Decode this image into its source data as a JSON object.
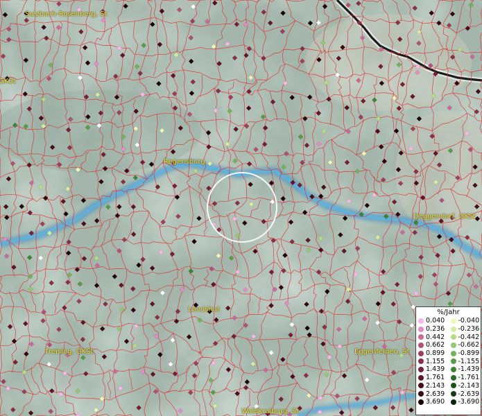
{
  "places": [
    {
      "id": "sulzbach",
      "label": "Sulzbach-Rosenberg, St"
    },
    {
      "id": "gkst-left",
      "label": "GKSt"
    },
    {
      "id": "regensburg",
      "label": "Regensburg"
    },
    {
      "id": "deggendorf",
      "label": "Deggendorf, GKSt"
    },
    {
      "id": "landshut",
      "label": "Landshut"
    },
    {
      "id": "freising",
      "label": "Freising, GKSt"
    },
    {
      "id": "eggenfelden",
      "label": "Eggenfelden, St"
    },
    {
      "id": "waldkraiburg",
      "label": "Waldkraiburg, St"
    }
  ],
  "legend": {
    "title": "%/Jahr",
    "positive": [
      {
        "value": "0.040",
        "color": "#f7b8e6"
      },
      {
        "value": "0.236",
        "color": "#e48cc4"
      },
      {
        "value": "0.442",
        "color": "#c96a98"
      },
      {
        "value": "0.662",
        "color": "#b25176"
      },
      {
        "value": "0.899",
        "color": "#9e3f5c"
      },
      {
        "value": "1.155",
        "color": "#8b2f48"
      },
      {
        "value": "1.439",
        "color": "#771f37"
      },
      {
        "value": "1.761",
        "color": "#621428"
      },
      {
        "value": "2.143",
        "color": "#4c0b1b"
      },
      {
        "value": "2.639",
        "color": "#330410"
      },
      {
        "value": "3.690",
        "color": "#1a0006"
      }
    ],
    "negative": [
      {
        "value": "-0.040",
        "color": "#eef6b8"
      },
      {
        "value": "-0.236",
        "color": "#d6eca0"
      },
      {
        "value": "-0.442",
        "color": "#b6dc88"
      },
      {
        "value": "-0.662",
        "color": "#94c870"
      },
      {
        "value": "-0.899",
        "color": "#74b35a"
      },
      {
        "value": "-1.155",
        "color": "#579c46"
      },
      {
        "value": "-1.439",
        "color": "#3e8434"
      },
      {
        "value": "-1.761",
        "color": "#2a6c25"
      },
      {
        "value": "-2.143",
        "color": "#1b5419"
      },
      {
        "value": "-2.639",
        "color": "#0f3d0f"
      },
      {
        "value": "-3.690",
        "color": "#062606"
      }
    ]
  },
  "colors": {
    "boundary": "#e02a2a",
    "river": "#4fa7d8",
    "label": "#f2e43a",
    "highlight_ring": "#ffffff"
  }
}
